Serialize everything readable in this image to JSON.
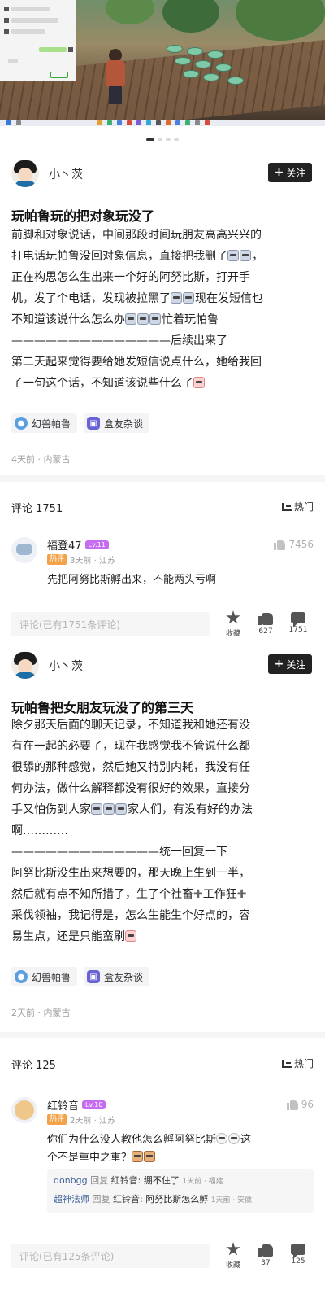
{
  "carousel": {
    "dots": 4,
    "active": 0
  },
  "post1": {
    "author": "小丶茨",
    "follow_label": "关注",
    "title": "玩帕鲁玩的把对象玩没了",
    "lines": [
      "前脚和对象说话，中间那段时间玩朋友高高兴兴的",
      "打电话玩帕鲁没回对象信息，直接把我删了",
      "正在构思怎么生出来一个好的阿努比斯，打开手",
      "机，发了个电话，发现被拉黑了",
      "现在发短信也",
      "不知道该说什么怎么办",
      "忙着玩帕鲁",
      "——————————————后续出来了",
      "第二天起来觉得要给她发短信说点什么，她给我回",
      "了一句这个话，不知道该说些什么了"
    ],
    "tags": [
      "幻兽帕鲁",
      "盒友杂谈"
    ],
    "meta": "4天前 · 内蒙古",
    "comments_label": "评论 1751",
    "sort_label": "热门",
    "top_comment": {
      "name": "福登47",
      "level": "Lv.11",
      "hot": "热评",
      "time": "3天前 · 江苏",
      "likes": "7456",
      "text": "先把阿努比斯孵出来，不能两头亏啊"
    },
    "input_placeholder": "评论(已有1751条评论)",
    "actions": {
      "fav": "收藏",
      "like": "627",
      "comment": "1751"
    }
  },
  "post2": {
    "author": "小丶茨",
    "follow_label": "关注",
    "title": "玩帕鲁把女朋友玩没了的第三天",
    "lines": [
      "除夕那天后面的聊天记录，不知道我和她还有没",
      "有在一起的必要了，现在我感觉我不管说什么都",
      "很舔的那种感觉，然后她又特别内耗，我没有任",
      "何办法，做什么解释都没有很好的效果，直接分",
      "手又怕伤到人家",
      "家人们，有没有好的办法",
      "啊…………",
      "—————————————统一回复一下",
      "阿努比斯没生出来想要的，那天晚上生到一半，",
      "然后就有点不知所措了，生了个社畜",
      "工作狂",
      "采伐领袖，我记得是，怎么生能生个好点的，容",
      "易生点，还是只能蛮刷"
    ],
    "tags": [
      "幻兽帕鲁",
      "盒友杂谈"
    ],
    "meta": "2天前 · 内蒙古",
    "comments_label": "评论 125",
    "sort_label": "热门",
    "top_comment": {
      "name": "红铃音",
      "level": "Lv.10",
      "hot": "热评",
      "time": "2天前 · 江苏",
      "likes": "96",
      "text1": "你们为什么没人教他怎么孵阿努比斯",
      "text1b": "这",
      "text2": "个不是重中之重？"
    },
    "replies": [
      {
        "name": "donbgg",
        "verb": "回复",
        "target": "红铃音:",
        "text": "绷不住了",
        "meta": "1天前 · 福建"
      },
      {
        "name": "超神法师",
        "verb": "回复",
        "target": "红铃音:",
        "text": "阿努比斯怎么孵",
        "meta": "1天前 · 安徽"
      }
    ],
    "input_placeholder": "评论(已有125条评论)",
    "actions": {
      "fav": "收藏",
      "like": "37",
      "comment": "125"
    }
  }
}
